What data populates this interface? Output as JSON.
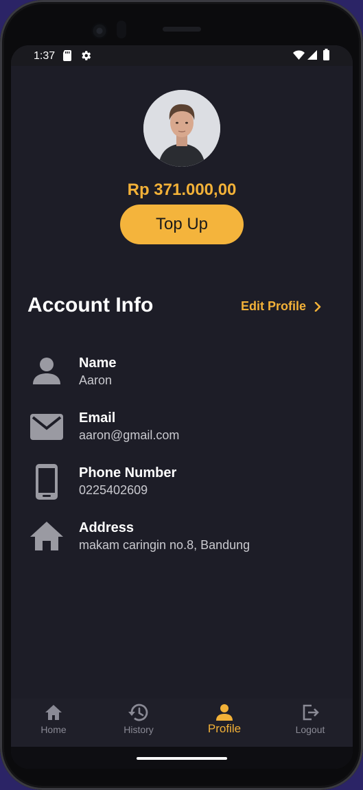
{
  "status_bar": {
    "time": "1:37"
  },
  "profile": {
    "balance": "Rp 371.000,00",
    "topup_label": "Top Up"
  },
  "account": {
    "title": "Account Info",
    "edit_label": "Edit Profile",
    "fields": [
      {
        "label": "Name",
        "value": "Aaron",
        "icon": "person-icon"
      },
      {
        "label": "Email",
        "value": "aaron@gmail.com",
        "icon": "mail-icon"
      },
      {
        "label": "Phone Number",
        "value": "0225402609",
        "icon": "phone-icon"
      },
      {
        "label": "Address",
        "value": "makam caringin no.8, Bandung",
        "icon": "home-icon"
      }
    ]
  },
  "nav": {
    "items": [
      {
        "label": "Home",
        "icon": "home-icon",
        "active": false
      },
      {
        "label": "History",
        "icon": "history-icon",
        "active": false
      },
      {
        "label": "Profile",
        "icon": "person-icon",
        "active": true
      },
      {
        "label": "Logout",
        "icon": "logout-icon",
        "active": false
      }
    ]
  },
  "colors": {
    "accent": "#f4b43c",
    "background": "#1d1d27",
    "icon_gray": "#9a9aa2"
  }
}
